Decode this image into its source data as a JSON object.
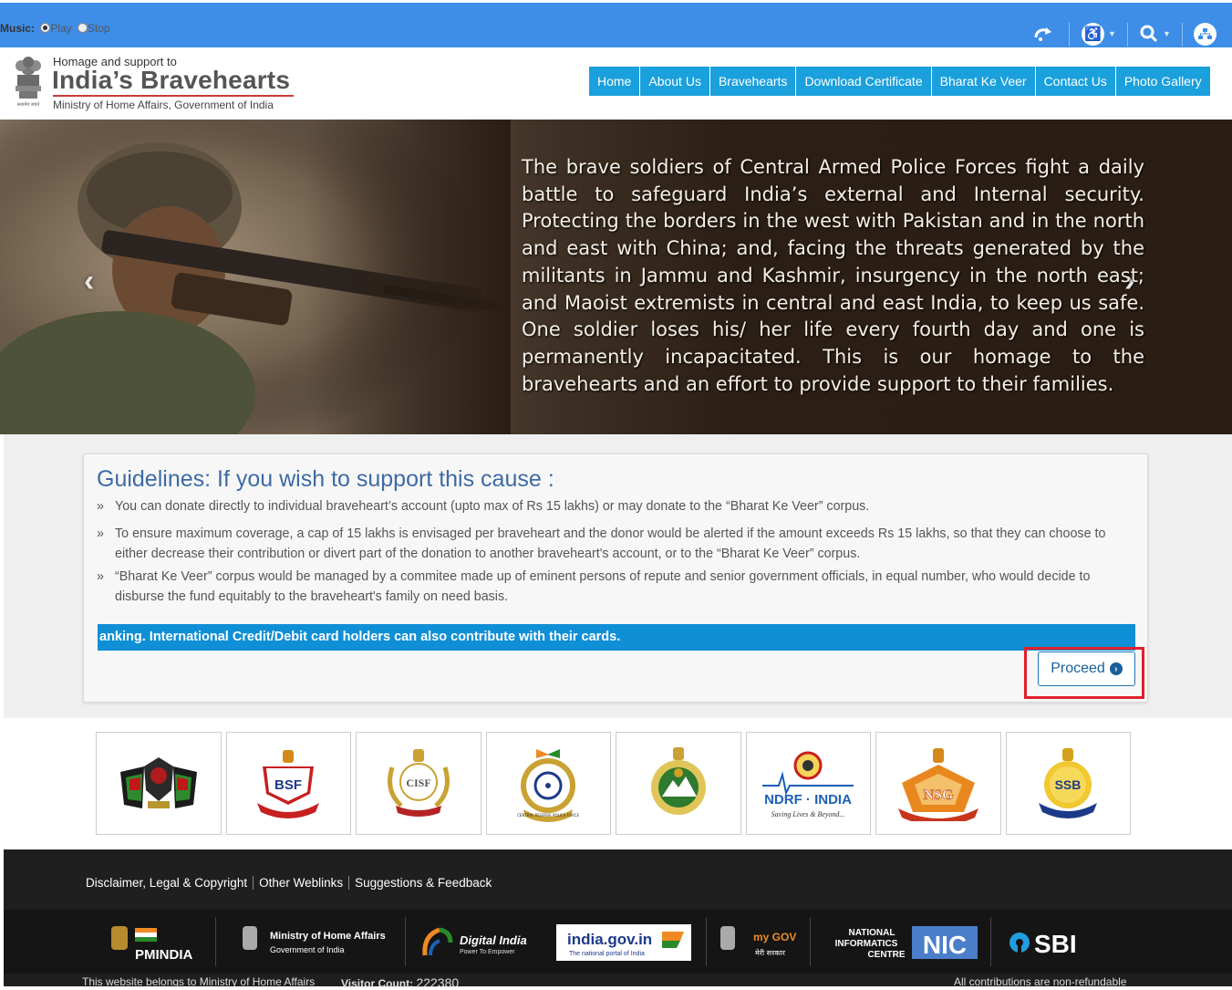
{
  "topbar": {
    "music_label": "Music:",
    "play_label": "Play",
    "stop_label": "Stop",
    "tools": [
      "refresh-icon",
      "accessibility-icon",
      "search-icon",
      "sitemap-icon"
    ]
  },
  "header": {
    "tagline": "Homage and support to",
    "title": "India’s Bravehearts",
    "subtitle": "Ministry of Home Affairs, Government of India",
    "emblem_caption": "सत्यमेव जयते"
  },
  "nav": {
    "items": [
      "Home",
      "About Us",
      "Bravehearts",
      "Download Certificate",
      "Bharat Ke Veer",
      "Contact Us",
      "Photo Gallery"
    ]
  },
  "hero": {
    "text": "The brave soldiers of Central Armed Police Forces fight a daily battle to safeguard India’s external and Internal security. Protecting the borders in the west with Pakistan and in the north and east with China; and, facing the threats generated by the militants in Jammu and Kashmir, insurgency in the north east; and Maoist extremists in central and east India, to keep us safe. One soldier loses his/ her life every fourth day and one is permanently incapacitated. This is our homage to the bravehearts and an effort to provide support to their families."
  },
  "guidelines": {
    "heading": "Guidelines: If you wish to support this cause :",
    "items": [
      "You can donate directly to individual braveheart’s account (upto max of Rs 15 lakhs) or may donate to the “Bharat Ke Veer” corpus.",
      "To ensure maximum coverage, a cap of 15 lakhs is envisaged per braveheart and the donor would be alerted if the amount exceeds Rs 15 lakhs, so that they can choose to either decrease their contribution or divert part of the donation to another braveheart's account, or to the “Bharat Ke Veer” corpus.",
      "“Bharat Ke Veer” corpus would be managed by a commitee made up of eminent persons of repute and senior government officials, in equal number, who would decide to disburse the fund equitably to the braveheart's family on need basis."
    ],
    "ticker": "anking. International Credit/Debit card holders can also contribute with their cards.",
    "proceed_label": "Proceed"
  },
  "logos": {
    "bsf": "BSF",
    "cisf": "CISF",
    "crpf_caption": "CENTRAL RESERVE POLICE FORCE",
    "ndrf": "NDRF · INDIA",
    "ndrf_tag": "Saving Lives & Beyond...",
    "nsg": "NSG",
    "ssb": "SSB"
  },
  "footer": {
    "links": [
      "Disclaimer, Legal & Copyright",
      "Other Weblinks",
      "Suggestions & Feedback"
    ],
    "partners": {
      "pmindia": "PMINDIA",
      "mha_line1": "Ministry of Home Affairs",
      "mha_line2": "Government of India",
      "digital_india": "Digital India",
      "digital_india_tag": "Power To Empower",
      "indiagov": "india.gov.in",
      "indiagov_tag": "The national portal of India",
      "mygov": "my GOV",
      "mygov_tag": "मेरी सरकार",
      "nic_line1": "NATIONAL",
      "nic_line2": "INFORMATICS",
      "nic_line3": "CENTRE",
      "nic_badge": "NIC",
      "sbi": "SBI"
    },
    "ownership": "This website belongs to Ministry of Home Affairs",
    "visitor_label": "Visitor Count:",
    "visitor_count": "222380",
    "refund_note": "All contributions are non-refundable"
  }
}
